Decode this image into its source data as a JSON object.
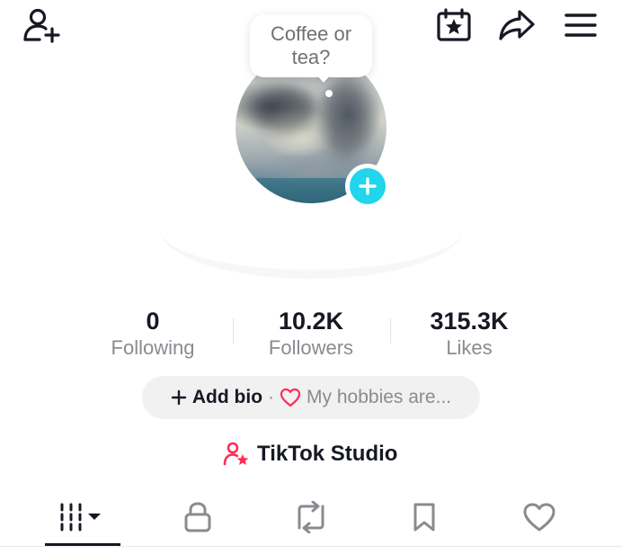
{
  "header": {
    "icons": [
      "add-friend-icon",
      "calendar-star-icon",
      "share-icon",
      "menu-icon"
    ]
  },
  "avatar": {
    "bubble_text": "Coffee or tea?",
    "badge_icon": "plus-icon",
    "badge_color": "#20d5ec"
  },
  "stats": [
    {
      "value": "0",
      "label": "Following"
    },
    {
      "value": "10.2K",
      "label": "Followers"
    },
    {
      "value": "315.3K",
      "label": "Likes"
    }
  ],
  "bio": {
    "add_label": "Add bio",
    "separator": "·",
    "hobbies_placeholder": "My hobbies are...",
    "heart_color": "#fe2c55"
  },
  "studio": {
    "label": "TikTok Studio",
    "icon_color": "#fe2c55"
  },
  "tabs": [
    {
      "icon": "videos-grid-icon",
      "active": true
    },
    {
      "icon": "lock-icon",
      "active": false
    },
    {
      "icon": "repost-icon",
      "active": false
    },
    {
      "icon": "bookmark-icon",
      "active": false
    },
    {
      "icon": "heart-icon",
      "active": false
    }
  ]
}
